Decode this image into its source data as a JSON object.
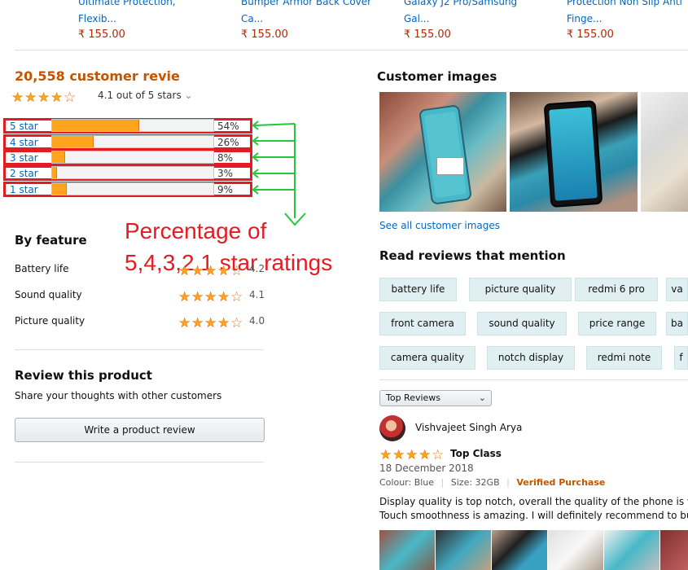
{
  "top_products": [
    {
      "title_line1": "Ultimate Protection,",
      "title_line2": "Flexib...",
      "price": "₹ 155.00"
    },
    {
      "title_line1": "Bumper Armor Back Cover",
      "title_line2": "Ca...",
      "price": "₹ 155.00"
    },
    {
      "title_line1": "Galaxy J2 Pro/Samsung",
      "title_line2": "Gal...",
      "price": "₹ 155.00"
    },
    {
      "title_line1": "Protection Non Slip Anti",
      "title_line2": "Finge...",
      "price": "₹ 155.00"
    }
  ],
  "reviews_summary": {
    "count_text": "20,558 customer revie",
    "rating_text": "4.1 out of 5 stars",
    "rating_value": 4.1,
    "dropdown_glyph": "⌄"
  },
  "histogram": [
    {
      "label": "5 star",
      "pct_text": "54%",
      "pct": 54
    },
    {
      "label": "4 star",
      "pct_text": "26%",
      "pct": 26
    },
    {
      "label": "3 star",
      "pct_text": "8%",
      "pct": 8
    },
    {
      "label": "2 star",
      "pct_text": "3%",
      "pct": 3
    },
    {
      "label": "1 star",
      "pct_text": "9%",
      "pct": 9
    }
  ],
  "annotation": {
    "line1": "Percentage of",
    "line2": "5,4,3,2,1 star ratings",
    "color": "#e31b23",
    "arrow_color": "#22c73a"
  },
  "by_feature": {
    "title": "By feature",
    "items": [
      {
        "label": "Battery life",
        "value": "4.2",
        "rating": 4.2
      },
      {
        "label": "Sound quality",
        "value": "4.1",
        "rating": 4.1
      },
      {
        "label": "Picture quality",
        "value": "4.0",
        "rating": 4.0
      }
    ]
  },
  "review_product": {
    "title": "Review this product",
    "subtitle": "Share your thoughts with other customers",
    "button": "Write a product review"
  },
  "customer_images": {
    "title": "Customer images",
    "see_all": "See all customer images"
  },
  "mentions": {
    "title": "Read reviews that mention",
    "rows": [
      [
        "battery life",
        "picture quality",
        "redmi 6 pro",
        "va"
      ],
      [
        "front camera",
        "sound quality",
        "price range",
        "ba"
      ],
      [
        "camera quality",
        "notch display",
        "redmi note",
        "f"
      ]
    ]
  },
  "sort": {
    "selected": "Top Reviews",
    "chevron": "⌄"
  },
  "review": {
    "author": "Vishvajeet Singh Arya",
    "rating": 4,
    "headline": "Top Class",
    "date": "18 December 2018",
    "colour": "Colour: Blue",
    "size": "Size: 32GB",
    "verified": "Verified Purchase",
    "body_line1": "Display quality is top notch, overall the quality of the phone is v",
    "body_line2": "Touch smoothness is amazing. I will definitely recommend to bu"
  },
  "colors": {
    "accent_orange": "#c45500",
    "link": "#0066c0",
    "price": "#b12704",
    "star": "#ffa41c"
  }
}
